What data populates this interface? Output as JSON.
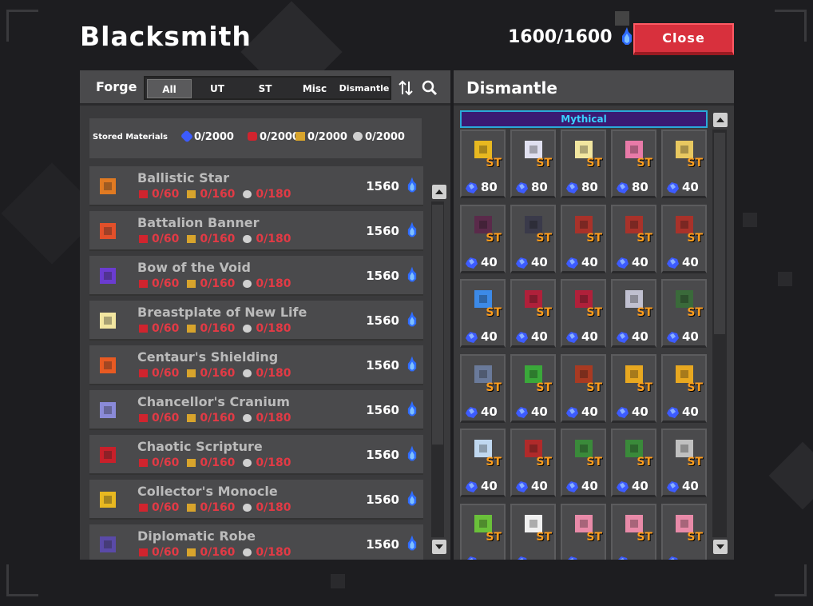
{
  "header": {
    "title": "Blacksmith",
    "essence": "1600/1600",
    "close_label": "Close"
  },
  "forge": {
    "label": "Forge",
    "tabs": [
      "All",
      "UT",
      "ST",
      "Misc",
      "Dismantle"
    ],
    "active_tab": "All",
    "materials": {
      "label": "Stored Materials",
      "values": [
        "0/2000",
        "0/2000",
        "0/2000",
        "0/2000"
      ],
      "icon_colors": [
        "#3c5bff",
        "#d0242e",
        "#d8a42c",
        "#d0d0d0"
      ]
    },
    "items": [
      {
        "name": "Ballistic Star",
        "reqs": [
          "0/60",
          "0/160",
          "0/180"
        ],
        "cost": "1560",
        "icon_color": "#e07a22"
      },
      {
        "name": "Battalion Banner",
        "reqs": [
          "0/60",
          "0/160",
          "0/180"
        ],
        "cost": "1560",
        "icon_color": "#e2502a"
      },
      {
        "name": "Bow of the Void",
        "reqs": [
          "0/60",
          "0/160",
          "0/180"
        ],
        "cost": "1560",
        "icon_color": "#6b3cd0"
      },
      {
        "name": "Breastplate of New Life",
        "reqs": [
          "0/60",
          "0/160",
          "0/180"
        ],
        "cost": "1560",
        "icon_color": "#f2e6a0"
      },
      {
        "name": "Centaur's Shielding",
        "reqs": [
          "0/60",
          "0/160",
          "0/180"
        ],
        "cost": "1560",
        "icon_color": "#e85a22"
      },
      {
        "name": "Chancellor's Cranium",
        "reqs": [
          "0/60",
          "0/160",
          "0/180"
        ],
        "cost": "1560",
        "icon_color": "#8a8ad8"
      },
      {
        "name": "Chaotic Scripture",
        "reqs": [
          "0/60",
          "0/160",
          "0/180"
        ],
        "cost": "1560",
        "icon_color": "#c8202a"
      },
      {
        "name": "Collector's Monocle",
        "reqs": [
          "0/60",
          "0/160",
          "0/180"
        ],
        "cost": "1560",
        "icon_color": "#e8b820"
      },
      {
        "name": "Diplomatic Robe",
        "reqs": [
          "0/60",
          "0/160",
          "0/180"
        ],
        "cost": "1560",
        "icon_color": "#5a4aa8"
      }
    ]
  },
  "dismantle": {
    "title": "Dismantle",
    "rarity": "Mythical",
    "tier_label": "ST",
    "cells": [
      {
        "value": "80",
        "color": "#e8b820"
      },
      {
        "value": "80",
        "color": "#e0e0f0"
      },
      {
        "value": "80",
        "color": "#f2e6a0"
      },
      {
        "value": "80",
        "color": "#e87aa8"
      },
      {
        "value": "40",
        "color": "#e8c860"
      },
      {
        "value": "40",
        "color": "#5a2a4a"
      },
      {
        "value": "40",
        "color": "#3a3a4a"
      },
      {
        "value": "40",
        "color": "#a8322a"
      },
      {
        "value": "40",
        "color": "#a8322a"
      },
      {
        "value": "40",
        "color": "#a8322a"
      },
      {
        "value": "40",
        "color": "#3c8ae8"
      },
      {
        "value": "40",
        "color": "#b0203a"
      },
      {
        "value": "40",
        "color": "#b0203a"
      },
      {
        "value": "40",
        "color": "#c0c0d0"
      },
      {
        "value": "40",
        "color": "#3a6a3a"
      },
      {
        "value": "40",
        "color": "#6a7a9a"
      },
      {
        "value": "40",
        "color": "#3aa83a"
      },
      {
        "value": "40",
        "color": "#a83a22"
      },
      {
        "value": "40",
        "color": "#e8a820"
      },
      {
        "value": "40",
        "color": "#e8a820"
      },
      {
        "value": "40",
        "color": "#c0d8f0"
      },
      {
        "value": "40",
        "color": "#b02a2a"
      },
      {
        "value": "40",
        "color": "#3a8a3a"
      },
      {
        "value": "40",
        "color": "#3a8a3a"
      },
      {
        "value": "40",
        "color": "#c0c0c0"
      },
      {
        "value": "",
        "color": "#6ac03a"
      },
      {
        "value": "",
        "color": "#f0f0f0"
      },
      {
        "value": "",
        "color": "#e88aa8"
      },
      {
        "value": "",
        "color": "#e88aa8"
      },
      {
        "value": "",
        "color": "#e88aa8"
      }
    ]
  },
  "colors": {
    "accent_red": "#d8303d",
    "req_red": "#e23a45",
    "essence_blue": "#3a8aff",
    "st_orange": "#ff9d1e",
    "mythical_bg": "#3a1a73"
  },
  "icons": {
    "essence": "blue-flame-icon",
    "sort": "sort-arrows-icon",
    "search": "magnifier-icon",
    "scroll_up": "arrow-up-icon",
    "scroll_down": "arrow-down-icon"
  }
}
